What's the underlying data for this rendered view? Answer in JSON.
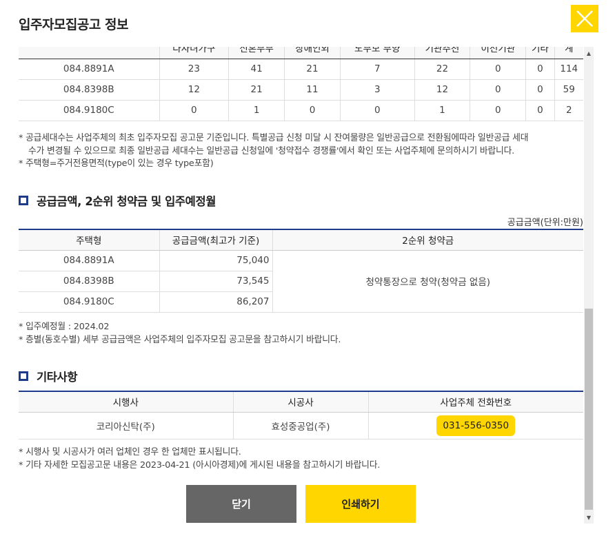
{
  "title": "입주자모집공고 정보",
  "top_table": {
    "headers": [
      "",
      "다자녀가구",
      "신혼부부",
      "장애인외",
      "노부모 부양",
      "기관추천",
      "이전기관",
      "기타",
      "계"
    ],
    "rows": [
      [
        "084.8891A",
        "23",
        "41",
        "21",
        "7",
        "22",
        "0",
        "0",
        "114"
      ],
      [
        "084.8398B",
        "12",
        "21",
        "11",
        "3",
        "12",
        "0",
        "0",
        "59"
      ],
      [
        "084.9180C",
        "0",
        "1",
        "0",
        "0",
        "1",
        "0",
        "0",
        "2"
      ]
    ]
  },
  "note1": {
    "line1": "* 공급세대수는 사업주체의 최초 입주자모집 공고문 기준입니다. 특별공급 신청 미달 시 잔여물량은 일반공급으로 전환됨에따라 일반공급 세대",
    "line2": "수가 변경될 수 있으므로 최종 일반공급 세대수는 일반공급 신청일에 '청약접수 경쟁률'에서 확인 또는 사업주체에 문의하시기 바랍니다.",
    "line3": "* 주택형=주거전용면적(type이 있는 경우 type포함)"
  },
  "section2": {
    "title": "공급금액, 2순위 청약금 및 입주예정월",
    "unit": "공급금액(단위:만원)",
    "headers": [
      "주택형",
      "공급금액(최고가 기준)",
      "2순위 청약금"
    ],
    "rows": [
      {
        "type": "084.8891A",
        "price": "75,040"
      },
      {
        "type": "084.8398B",
        "price": "73,545"
      },
      {
        "type": "084.9180C",
        "price": "86,207"
      }
    ],
    "deposit": "청약통장으로 청약(청약금 없음)",
    "note_line1": "* 입주예정월 : 2024.02",
    "note_line2": "* 층별(동호수별) 세부 공급금액은 사업주체의 입주자모집 공고문을 참고하시기 바랍니다."
  },
  "section3": {
    "title": "기타사항",
    "headers": [
      "시행사",
      "시공사",
      "사업주체 전화번호"
    ],
    "developer": "코리아신탁(주)",
    "builder": "효성중공업(주)",
    "phone": "031-556-0350",
    "note_line1": "* 시행사 및 시공사가 여러 업체인 경우 한 업체만 표시됩니다.",
    "note_line2": "* 기타 자세한 모집공고문 내용은 2023-04-21 (아시아경제)에 게시된 내용을 참고하시기 바랍니다."
  },
  "buttons": {
    "close": "닫기",
    "print": "인쇄하기"
  }
}
